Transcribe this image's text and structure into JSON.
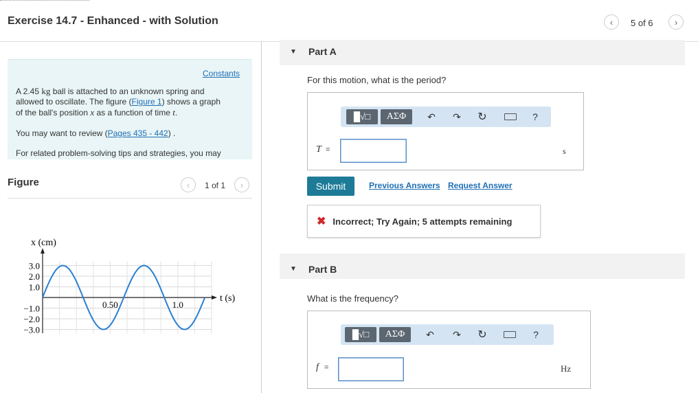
{
  "header": {
    "title": "Exercise 14.7 - Enhanced - with Solution",
    "pager_text": "5 of 6",
    "prev_icon": "chevron-left-icon",
    "next_icon": "chevron-right-icon"
  },
  "problem": {
    "constants_link": "Constants",
    "line1_pre": "A 2.45 ",
    "line1_unit": "kg",
    "line1_post": " ball is attached to an unknown spring and",
    "line2_pre": "allowed to oscillate. The figure (",
    "line2_link": "Figure 1",
    "line2_post": ") shows a graph",
    "line3_pre": "of the ball's position ",
    "line3_var1": "x",
    "line3_mid": " as a function of time ",
    "line3_var2": "t",
    "line3_post": ".",
    "review_pre": "You may want to review (",
    "review_link": "Pages 435 - 442",
    "review_post": ") .",
    "tips": "For related problem-solving tips and strategies, you may"
  },
  "figure": {
    "label": "Figure",
    "pager_text": "1 of 1"
  },
  "chart_data": {
    "type": "line",
    "xlabel": "t (s)",
    "ylabel": "x (cm)",
    "x_ticks": [
      "0.50",
      "1.0"
    ],
    "y_ticks": [
      "3.0",
      "2.0",
      "1.0",
      "−1.0",
      "−2.0",
      "−3.0"
    ],
    "series": [
      {
        "function": "x = 3.0 sin(2π t / 0.60)",
        "amplitude": 3.0,
        "period": 0.6,
        "t_range": [
          0,
          1.2
        ]
      }
    ]
  },
  "partA": {
    "title": "Part A",
    "question": "For this motion, what is the period?",
    "toolbar_greek": "ΑΣΦ",
    "help": "?",
    "var": "T",
    "eq": "=",
    "input_value": "",
    "unit": "s",
    "submit": "Submit",
    "previous_answers": "Previous Answers",
    "request_answer": "Request Answer",
    "feedback": "Incorrect; Try Again; 5 attempts remaining"
  },
  "partB": {
    "title": "Part B",
    "question": "What is the frequency?",
    "toolbar_greek": "ΑΣΦ",
    "help": "?",
    "var": "f",
    "eq": "=",
    "input_value": "",
    "unit": "Hz"
  },
  "colors": {
    "problem_bg": "#e9f5f6",
    "submit_bg": "#1d7b97",
    "link": "#1f6fb6",
    "toolbar_bg": "#d4e4f3",
    "error": "#d0282b"
  }
}
